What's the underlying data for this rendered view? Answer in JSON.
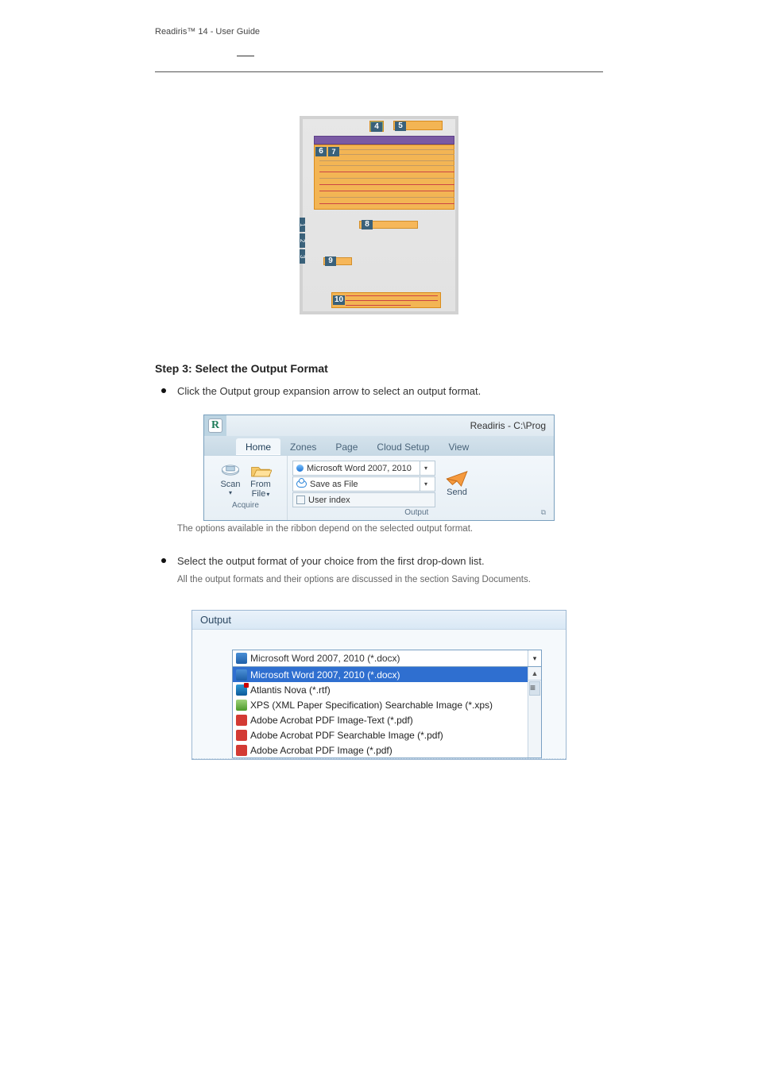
{
  "header": {
    "title": "Readiris™ 14 - User Guide",
    "underscore": " "
  },
  "fig1": {
    "markers": {
      "m1": "1",
      "m2": "2",
      "m3": "3",
      "m4": "4",
      "m5": "5",
      "m6": "6",
      "m7": "7",
      "m8": "8",
      "m9": "9",
      "m10": "10"
    }
  },
  "step1": {
    "heading": "Step 3: Select the Output Format"
  },
  "bullet1": {
    "text": "Click the Output group expansion arrow to select an output format."
  },
  "ribbon": {
    "windowTitle": "Readiris - C:\\Prog",
    "tabs": {
      "home": "Home",
      "zones": "Zones",
      "page": "Page",
      "cloud": "Cloud Setup",
      "view": "View"
    },
    "acquire": {
      "scan": "Scan",
      "scan_dd": "▾",
      "from": "From",
      "file": "File",
      "file_dd": "▾",
      "group": "Acquire"
    },
    "output": {
      "field1": "Microsoft Word 2007, 2010",
      "field2": "Save as File",
      "field3": "User index",
      "group": "Output",
      "dd": "▾"
    },
    "send": {
      "label": "Send"
    },
    "launcher": "▾"
  },
  "note_under_ribbon": "The options available in the ribbon depend on the selected output format.",
  "bullet2": {
    "text": "Select the output format of your choice from the first drop-down list."
  },
  "bullet2_note": "All the output formats and their options are discussed in the section Saving Documents.",
  "dlg": {
    "title": "Output",
    "combo": {
      "label": "Microsoft Word 2007, 2010 (*.docx)",
      "dd": "▾"
    },
    "items": {
      "i1": "Microsoft Word 2007, 2010 (*.docx)",
      "i2": "Atlantis Nova (*.rtf)",
      "i3": "XPS (XML Paper Specification) Searchable Image (*.xps)",
      "i4": "Adobe Acrobat PDF Image-Text (*.pdf)",
      "i5": "Adobe Acrobat PDF Searchable Image (*.pdf)",
      "i6": "Adobe Acrobat PDF Image (*.pdf)"
    },
    "scroll": {
      "up": "▲",
      "down": "",
      "thumb": "≡"
    }
  }
}
